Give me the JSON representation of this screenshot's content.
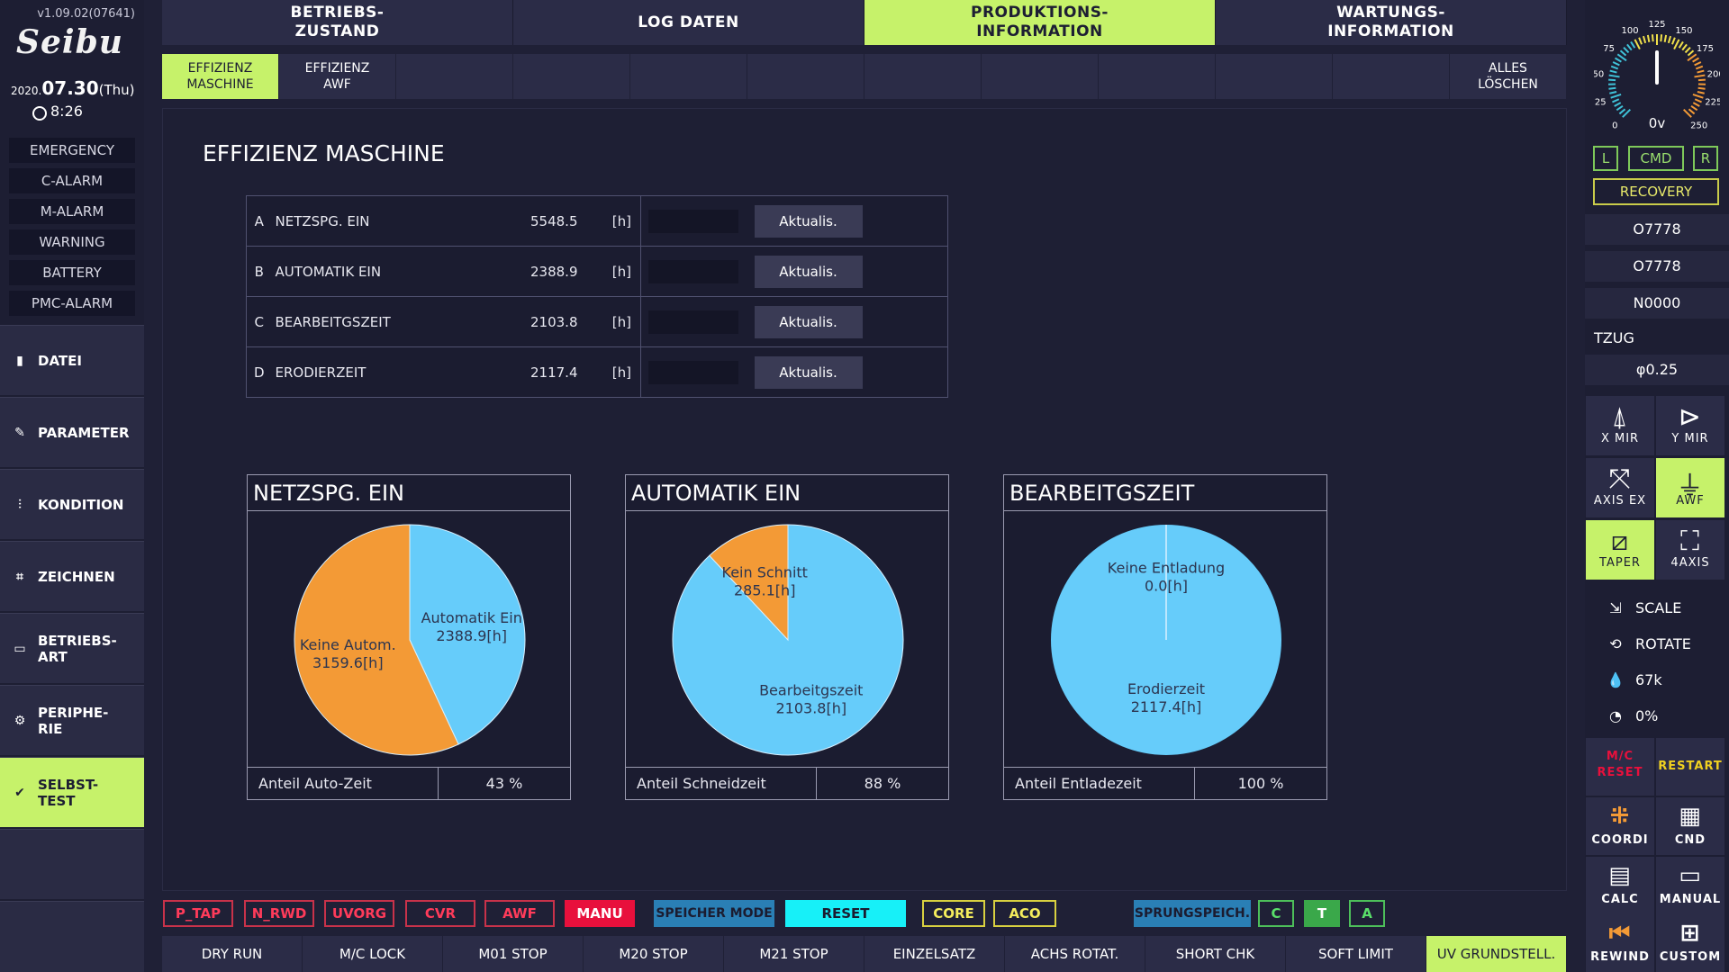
{
  "version": "v1.09.02(07641)",
  "logo": "Seibu",
  "date_prefix": "2020.",
  "date_main": "07.30",
  "weekday": "(Thu)",
  "time": "8:26",
  "alarms": [
    "EMERGENCY",
    "C-ALARM",
    "M-ALARM",
    "WARNING",
    "BATTERY",
    "PMC-ALARM"
  ],
  "menu": [
    {
      "label": "DATEI",
      "icon": "file-icon"
    },
    {
      "label": "PARAMETER",
      "icon": "wrench-icon"
    },
    {
      "label": "KONDITION",
      "icon": "sliders-icon"
    },
    {
      "label": "ZEICHNEN",
      "icon": "draw-icon"
    },
    {
      "label": "BETRIEBS-\nART",
      "icon": "mode-icon"
    },
    {
      "label": "PERIPHE-\nRIE",
      "icon": "gear-icon"
    },
    {
      "label": "SELBST-\nTEST",
      "icon": "check-icon"
    }
  ],
  "top_tabs": [
    "BETRIEBS-\nZUSTAND",
    "LOG DATEN",
    "PRODUKTIONS-\nINFORMATION",
    "WARTUNGS-\nINFORMATION"
  ],
  "sub_tabs": [
    "EFFIZIENZ\nMASCHINE",
    "EFFIZIENZ\nAWF"
  ],
  "clear_all": "ALLES\nLÖSCHEN",
  "page_title": "EFFIZIENZ MASCHINE",
  "table": [
    {
      "letter": "A",
      "name": "NETZSPG. EIN",
      "value": "5548.5",
      "unit": "[h]",
      "button": "Aktualis."
    },
    {
      "letter": "B",
      "name": "AUTOMATIK EIN",
      "value": "2388.9",
      "unit": "[h]",
      "button": "Aktualis."
    },
    {
      "letter": "C",
      "name": "BEARBEITGSZEIT",
      "value": "2103.8",
      "unit": "[h]",
      "button": "Aktualis."
    },
    {
      "letter": "D",
      "name": "ERODIERZEIT",
      "value": "2117.4",
      "unit": "[h]",
      "button": "Aktualis."
    }
  ],
  "pies": [
    {
      "title": "NETZSPG. EIN",
      "footer_label": "Anteil Auto-Zeit",
      "footer_value": "43 %",
      "slices": [
        {
          "label": "Automatik Ein",
          "value_text": "2388.9[h]",
          "value": 2388.9,
          "color": "#66ccfa"
        },
        {
          "label": "Keine Autom.",
          "value_text": "3159.6[h]",
          "value": 3159.6,
          "color": "#f39a36"
        }
      ]
    },
    {
      "title": "AUTOMATIK EIN",
      "footer_label": "Anteil Schneidzeit",
      "footer_value": "88 %",
      "slices": [
        {
          "label": "Bearbeitgszeit",
          "value_text": "2103.8[h]",
          "value": 2103.8,
          "color": "#66ccfa"
        },
        {
          "label": "Kein Schnitt",
          "value_text": "285.1[h]",
          "value": 285.1,
          "color": "#f39a36"
        }
      ]
    },
    {
      "title": "BEARBEITGSZEIT",
      "footer_label": "Anteil Entladezeit",
      "footer_value": "100 %",
      "slices": [
        {
          "label": "Erodierzeit",
          "value_text": "2117.4[h]",
          "value": 2117.4,
          "color": "#66ccfa"
        },
        {
          "label": "Keine Entladung",
          "value_text": "0.0[h]",
          "value": 0.0,
          "color": "#f39a36"
        }
      ]
    }
  ],
  "gauge": {
    "ticks": [
      "0",
      "25",
      "50",
      "75",
      "100",
      "125",
      "150",
      "175",
      "200",
      "225",
      "250"
    ],
    "value": "0v",
    "reading": 125
  },
  "lcr": [
    "L",
    "CMD",
    "R"
  ],
  "recovery": "RECOVERY",
  "program_rows": [
    "O7778",
    "O7778",
    "N0000"
  ],
  "tzug": "TZUG",
  "phi": "φ0.25",
  "icon_buttons": [
    {
      "label": "X MIR",
      "icon": "x-mirror-icon",
      "glyph": "⍋"
    },
    {
      "label": "Y MIR",
      "icon": "y-mirror-icon",
      "glyph": "⊳"
    },
    {
      "label": "AXIS EX",
      "icon": "axis-exchange-icon",
      "glyph": "⤧"
    },
    {
      "label": "AWF",
      "icon": "awf-icon",
      "glyph": "⏚"
    },
    {
      "label": "TAPER",
      "icon": "taper-icon",
      "glyph": "⧄"
    },
    {
      "label": "4AXIS",
      "icon": "4axis-icon",
      "glyph": "⛶"
    }
  ],
  "small_rows": [
    {
      "label": "SCALE",
      "icon": "scale-icon",
      "glyph": "⇲"
    },
    {
      "label": "ROTATE",
      "icon": "rotate-icon",
      "glyph": "⟲"
    },
    {
      "label": "67k",
      "icon": "drop-icon",
      "glyph": "💧"
    },
    {
      "label": "0%",
      "icon": "gauge-icon",
      "glyph": "◔"
    }
  ],
  "mc_reset": "M/C\nRESET",
  "restart": "RESTART",
  "bottom_icon_buttons": [
    {
      "label": "COORDI",
      "icon": "coordinate-icon",
      "glyph": "⁜"
    },
    {
      "label": "CND",
      "icon": "condition-icon",
      "glyph": "▦"
    },
    {
      "label": "CALC",
      "icon": "calculator-icon",
      "glyph": "▤"
    },
    {
      "label": "MANUAL",
      "icon": "manual-icon",
      "glyph": "▭"
    },
    {
      "label": "REWIND",
      "icon": "rewind-icon",
      "glyph": "⏮"
    },
    {
      "label": "CUSTOM",
      "icon": "custom-icon",
      "glyph": "⊞"
    }
  ],
  "status_bar": [
    "P_TAP",
    "N_RWD",
    "UVORG",
    "CVR",
    "AWF",
    "MANU",
    "SPEICHER MODE",
    "RESET",
    "CORE",
    "ACO",
    "SPRUNGSPEICH.",
    "C",
    "T",
    "A"
  ],
  "bottom_buttons": [
    "DRY RUN",
    "M/C LOCK",
    "M01 STOP",
    "M20 STOP",
    "M21 STOP",
    "EINZELSATZ",
    "ACHS ROTAT.",
    "SHORT CHK",
    "SOFT LIMIT",
    "UV GRUNDSTELL."
  ]
}
